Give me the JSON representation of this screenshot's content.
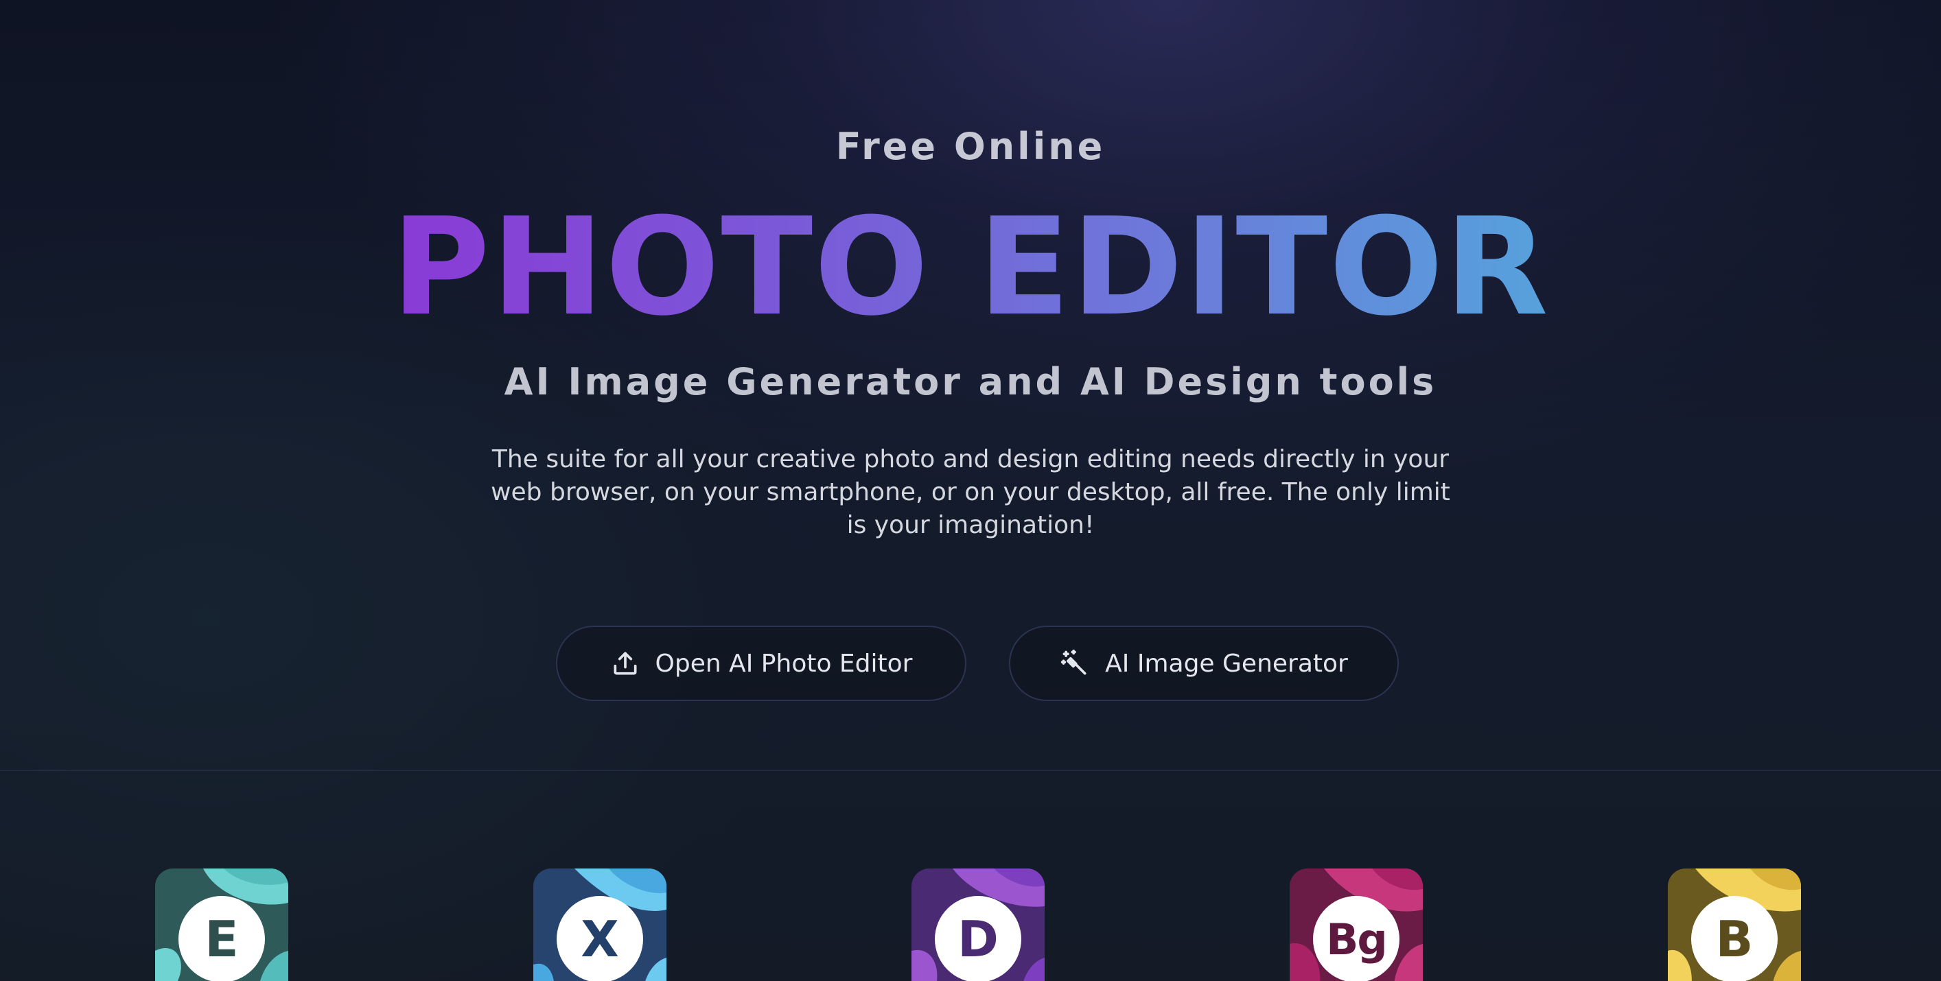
{
  "hero": {
    "eyebrow": "Free Online",
    "title": "PHOTO EDITOR",
    "subtitle": "AI Image Generator and AI Design tools",
    "description": "The suite for all your creative photo and design editing needs directly in your web browser, on your smartphone, or on your desktop, all free. The only limit is your imagination!"
  },
  "buttons": {
    "open_editor": {
      "label": "Open AI Photo Editor",
      "icon": "upload-icon"
    },
    "image_generator": {
      "label": "AI Image Generator",
      "icon": "magic-wand-icon"
    }
  },
  "apps": [
    {
      "letter": "E",
      "icon": "app-e-icon",
      "colors": {
        "dark": "#2f5a5a",
        "light": "#6fd3d2",
        "mid": "#55bcbc",
        "text": "#2f4f4f"
      }
    },
    {
      "letter": "X",
      "icon": "app-x-icon",
      "colors": {
        "dark": "#26446e",
        "light": "#6ccaf0",
        "mid": "#4aa8e0",
        "text": "#23406a"
      }
    },
    {
      "letter": "D",
      "icon": "app-d-icon",
      "colors": {
        "dark": "#4a2a72",
        "light": "#9a55cf",
        "mid": "#7d3fc0",
        "text": "#4a2a72"
      }
    },
    {
      "letter": "Bg",
      "icon": "app-bg-icon",
      "colors": {
        "dark": "#6a1c46",
        "light": "#c7377c",
        "mid": "#a92266",
        "text": "#5e1a3e"
      }
    },
    {
      "letter": "B",
      "icon": "app-b-icon",
      "colors": {
        "dark": "#6b5a1f",
        "light": "#f3d25c",
        "mid": "#dbb23a",
        "text": "#5a4c1c"
      }
    }
  ]
}
